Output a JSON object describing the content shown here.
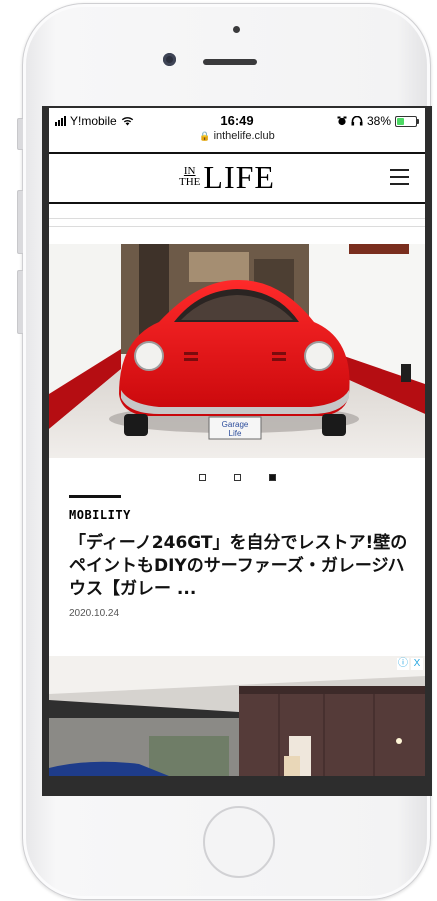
{
  "status_bar": {
    "carrier": "Y!mobile",
    "time": "16:49",
    "url": "inthelife.club",
    "battery_pct": "38%",
    "battery_level": 0.38,
    "battery_color": "#4cd964"
  },
  "header": {
    "logo_in": "IN",
    "logo_the": "THE",
    "logo_life": "LIFE",
    "menu_icon": "hamburger-icon"
  },
  "carousel": {
    "slide_count": 3,
    "active_index": 2,
    "image": "red-sports-car-in-garage"
  },
  "article": {
    "category": "MOBILITY",
    "title": "「ディーノ246GT」を自分でレストア!壁のペイントもDIYのサーファーズ・ガレージハウス【ガレー ...",
    "date": "2020.10.24",
    "plate_line1": "Garage",
    "plate_line2": "Life"
  },
  "ad": {
    "info_icon": "ⓘ",
    "close_icon": "X",
    "image": "interior-garage-ad"
  },
  "colors": {
    "accent": "#d90d12",
    "text": "#111111"
  }
}
